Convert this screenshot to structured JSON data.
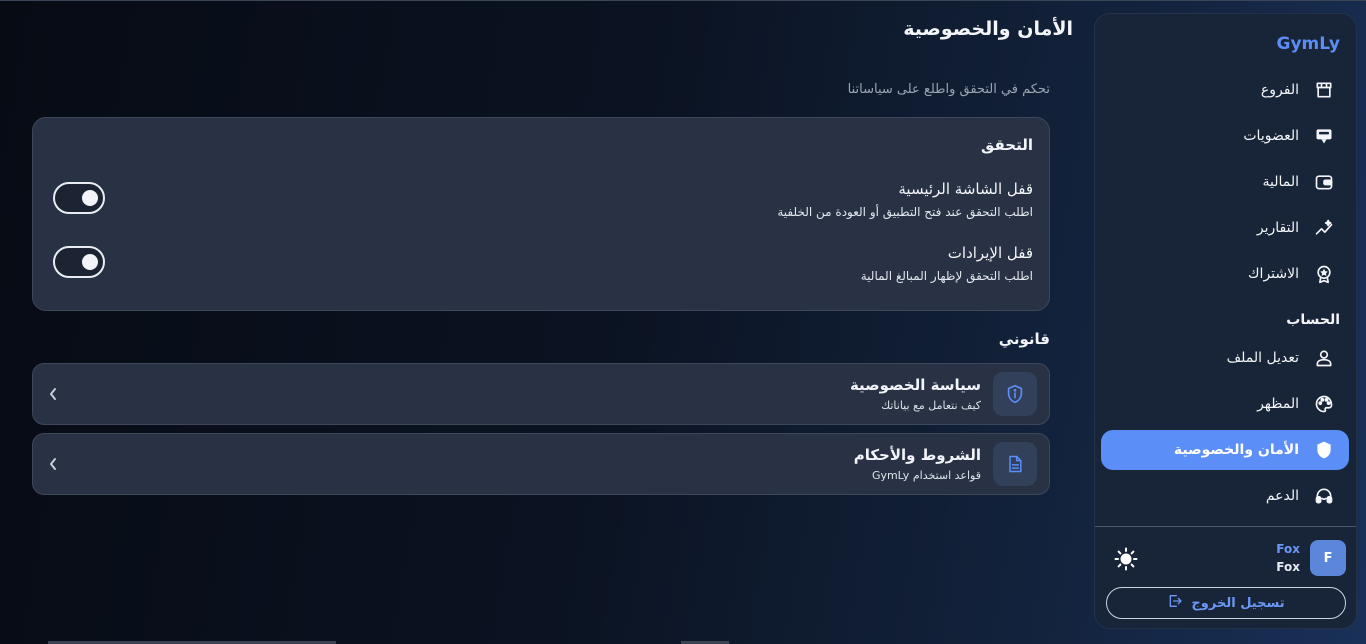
{
  "sidebar": {
    "brand": "GymLy",
    "items": [
      {
        "label": "الفروع",
        "icon": "store-icon"
      },
      {
        "label": "العضويات",
        "icon": "id-card-icon"
      },
      {
        "label": "المالية",
        "icon": "wallet-icon"
      },
      {
        "label": "التقارير",
        "icon": "analytics-icon"
      },
      {
        "label": "الاشتراك",
        "icon": "award-icon"
      }
    ],
    "account_title": "الحساب",
    "account_items": [
      {
        "label": "تعديل الملف",
        "icon": "user-icon"
      },
      {
        "label": "المظهر",
        "icon": "palette-icon"
      },
      {
        "label": "الأمان والخصوصية",
        "icon": "shield-icon",
        "active": true
      },
      {
        "label": "الدعم",
        "icon": "headset-icon"
      }
    ],
    "user": {
      "initial": "F",
      "name": "Fox",
      "subname": "Fox"
    },
    "logout_label": "تسجيل الخروج"
  },
  "main": {
    "title": "الأمان والخصوصية",
    "subtitle": "تحكم في التحقق واطلع على سياساتنا",
    "verification": {
      "title": "التحقق",
      "settings": [
        {
          "title": "قفل الشاشة الرئيسية",
          "description": "اطلب التحقق عند فتح التطبيق أو العودة من الخلفية",
          "enabled": true
        },
        {
          "title": "قفل الإيرادات",
          "description": "اطلب التحقق لإظهار المبالغ المالية",
          "enabled": true
        }
      ]
    },
    "legal": {
      "title": "قانوني",
      "items": [
        {
          "title": "سياسة الخصوصية",
          "description": "كيف نتعامل مع بياناتك",
          "icon": "info-shield-icon"
        },
        {
          "title": "الشروط والأحكام",
          "description": "قواعد استخدام GymLy",
          "icon": "document-icon"
        }
      ]
    }
  },
  "colors": {
    "accent": "#5b8ef7",
    "card": "#283244",
    "sidebar": "#182437"
  }
}
